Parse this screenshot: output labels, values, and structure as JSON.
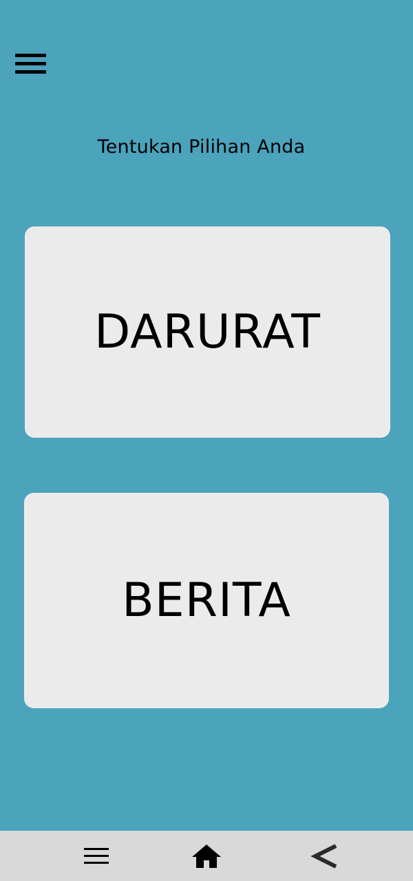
{
  "header": {
    "menu_icon": "hamburger-menu-icon"
  },
  "main": {
    "title": "Tentukan Pilihan Anda",
    "options": [
      {
        "label": "DARURAT"
      },
      {
        "label": "BERITA"
      }
    ]
  },
  "navbar": {
    "items": [
      {
        "icon": "menu-icon"
      },
      {
        "icon": "home-icon"
      },
      {
        "icon": "back-icon"
      }
    ]
  },
  "colors": {
    "background": "#4BA3BC",
    "card": "#EBEBEB",
    "navbar": "#D9D9D9",
    "text": "#000000"
  }
}
